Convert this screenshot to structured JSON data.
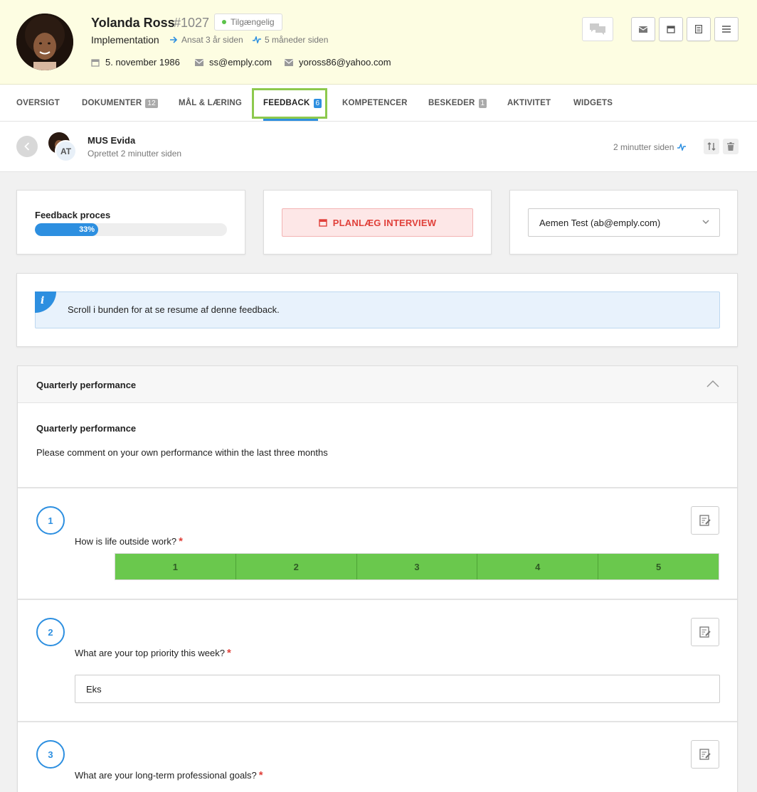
{
  "header": {
    "name": "Yolanda Ross",
    "employee_id": "#1027",
    "status": "Tilgængelig",
    "department": "Implementation",
    "hired": "Ansat 3 år siden",
    "activity": "5 måneder siden",
    "birthday": "5. november 1986",
    "email_work": "ss@emply.com",
    "email_private": "yoross86@yahoo.com",
    "actions": [
      "chat-icon",
      "mail-icon",
      "calendar-icon",
      "document-icon",
      "menu-icon"
    ]
  },
  "tabs": [
    {
      "label": "OVERSIGT",
      "count": ""
    },
    {
      "label": "DOKUMENTER",
      "count": "12"
    },
    {
      "label": "MÅL & LÆRING",
      "count": ""
    },
    {
      "label": "FEEDBACK",
      "count": "6",
      "active": true
    },
    {
      "label": "KOMPETENCER",
      "count": ""
    },
    {
      "label": "BESKEDER",
      "count": "1"
    },
    {
      "label": "AKTIVITET",
      "count": ""
    },
    {
      "label": "WIDGETS",
      "count": ""
    }
  ],
  "feedback": {
    "title": "MUS Evida",
    "created": "Oprettet 2 minutter siden",
    "updated": "2 minutter siden",
    "avatar_initials": "AT"
  },
  "cards": {
    "progress_label": "Feedback proces",
    "progress_value": 33,
    "progress_text": "33%",
    "plan_button": "PLANLÆG INTERVIEW",
    "reviewer": "Aemen Test (ab@emply.com)"
  },
  "info": {
    "icon": "i",
    "text": "Scroll i bunden for at se resume af denne feedback."
  },
  "section": {
    "header_title": "Quarterly performance",
    "intro_title": "Quarterly performance",
    "intro_text": "Please comment on your own performance within the last three months",
    "questions": [
      {
        "number": "1",
        "text": "How is life outside work?",
        "required": "*",
        "scale": [
          "1",
          "2",
          "3",
          "4",
          "5"
        ]
      },
      {
        "number": "2",
        "text": "What are your top priority this week?",
        "required": "*",
        "answer": "Eks"
      },
      {
        "number": "3",
        "text": "What are your long-term professional goals?",
        "required": "*"
      }
    ]
  },
  "colors": {
    "accent": "#2d8fe0",
    "success": "#6ac84d",
    "danger": "#e0403a",
    "header_bg": "#fdfde2",
    "focus_outline": "#8dc94d"
  }
}
